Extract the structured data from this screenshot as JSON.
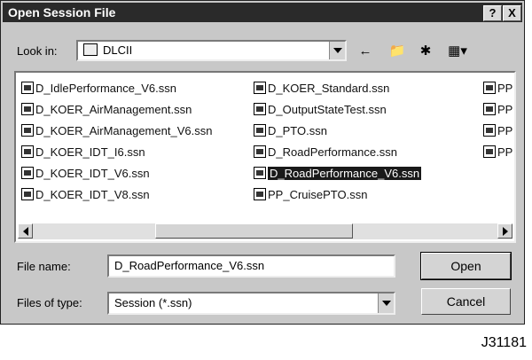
{
  "dialog": {
    "title": "Open Session File",
    "help_label": "?",
    "close_label": "X"
  },
  "look_in": {
    "label": "Look in:",
    "value": "DLCII"
  },
  "files": {
    "col1": [
      "D_IdlePerformance_V6.ssn",
      "D_KOER_AirManagement.ssn",
      "D_KOER_AirManagement_V6.ssn",
      "D_KOER_IDT_I6.ssn",
      "D_KOER_IDT_V6.ssn",
      "D_KOER_IDT_V8.ssn"
    ],
    "col2": [
      "D_KOER_Standard.ssn",
      "D_OutputStateTest.ssn",
      "D_PTO.ssn",
      "D_RoadPerformance.ssn",
      "D_RoadPerformance_V6.ssn",
      "PP_CruisePTO.ssn"
    ],
    "col3": [
      "PP",
      "PP",
      "PP",
      "PP"
    ],
    "selected": "D_RoadPerformance_V6.ssn"
  },
  "file_name": {
    "label": "File name:",
    "value": "D_RoadPerformance_V6.ssn"
  },
  "file_type": {
    "label": "Files of type:",
    "value": "Session (*.ssn)"
  },
  "buttons": {
    "open": "Open",
    "cancel": "Cancel"
  },
  "figure_code": "J31181"
}
